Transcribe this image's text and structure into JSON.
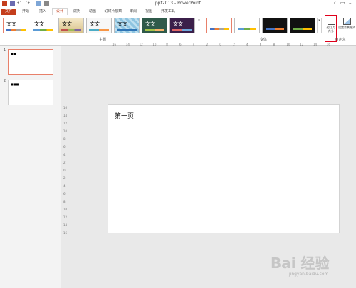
{
  "window": {
    "title": "ppt2013 - PowerPoint",
    "help": "?"
  },
  "tabs": [
    {
      "label": "文件"
    },
    {
      "label": "开始"
    },
    {
      "label": "插入"
    },
    {
      "label": "设计"
    },
    {
      "label": "切换"
    },
    {
      "label": "动画"
    },
    {
      "label": "幻灯片放映"
    },
    {
      "label": "审阅"
    },
    {
      "label": "视图"
    },
    {
      "label": "开发工具"
    }
  ],
  "ribbon": {
    "theme_sample": "文文",
    "groups": {
      "themes": "主题",
      "variants": "变体",
      "customize": "自定义"
    },
    "buttons": {
      "slide_size": "幻灯片大小",
      "format_background": "设置背景格式"
    }
  },
  "slides": [
    {
      "number": "1",
      "mini_text": "■■"
    },
    {
      "number": "2",
      "mini_text": "■■■"
    }
  ],
  "ruler_labels": [
    "16",
    "14",
    "12",
    "10",
    "8",
    "6",
    "4",
    "2",
    "0",
    "2",
    "4",
    "6",
    "8",
    "10",
    "12",
    "14",
    "16"
  ],
  "slide": {
    "title": "第一页"
  },
  "watermark": {
    "text": "Bai 经验",
    "sub": "jingyan.baidu.com"
  },
  "colors": {
    "accent": "#c43e1c",
    "selection": "#e8806a"
  }
}
